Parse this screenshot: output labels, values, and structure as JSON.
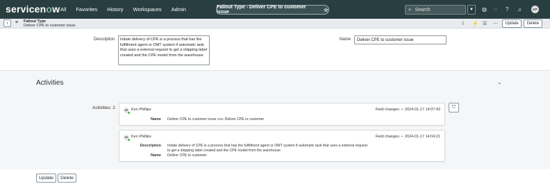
{
  "topbar": {
    "logo_text_a": "servicen",
    "logo_text_o": "o",
    "logo_text_b": "w",
    "nav": [
      "All",
      "Favorites",
      "History",
      "Workspaces",
      "Admin"
    ],
    "page_title": "Fallout Type - Deliver CPE to customer issue",
    "search_placeholder": "Search",
    "avatar_initials": "KP"
  },
  "form_header": {
    "record_type": "Fallout Type",
    "record_name": "Deliver CPE to customer issue",
    "update_label": "Update",
    "delete_label": "Delete"
  },
  "fields": {
    "description_label": "Description",
    "description_value": "Initate delivery of CPE is a process that has the fulfillment agent or OMT system if automatic task that uses a external request to get a shipping label created and the CPE model from the warehouse",
    "name_label": "Name",
    "name_value": "Deliver CPE to customer issue"
  },
  "activities": {
    "title": "Activities",
    "count_label": "Activities: 2",
    "entries": [
      {
        "initials": "KP",
        "user": "Ken Phillips",
        "type": "Field changes",
        "timestamp": "2024-01-17 14:07:43",
        "name_label": "Name",
        "name_new": "Deliver CPE to customer issue",
        "was_word": "was",
        "name_old": "Deliver CPE to customer"
      },
      {
        "initials": "KP",
        "user": "Ken Phillips",
        "type": "Field changes",
        "timestamp": "2024-01-17 14:04:21",
        "desc_label": "Description",
        "desc_value": "Initate delivery of CPE is a process that has the fulfillment agent or OMT system if automatic task that uses a external request to get a shipping label created and the CPE model from the warehouse",
        "name_label": "Name",
        "name_value": "Deliver CPE to customer"
      }
    ]
  },
  "footer": {
    "update_label": "Update",
    "delete_label": "Delete"
  },
  "icons": {
    "star": "star-icon",
    "search": "search-icon",
    "globe": "globe-icon",
    "chat": "chat-icon",
    "help": "help-icon",
    "bell": "bell-icon",
    "back": "chevron-left-icon",
    "menu": "hamburger-icon",
    "attach": "paperclip-icon",
    "activity": "activity-icon",
    "settings": "sliders-icon",
    "more": "more-icon",
    "collapse": "chevron-down-icon",
    "filter": "filter-icon"
  },
  "colors": {
    "nav_bg": "#293e40",
    "logo_accent": "#81b5a1",
    "header_bg": "#e9ecee",
    "activities_bg": "#f5f6f7",
    "presence": "#4caf50"
  }
}
